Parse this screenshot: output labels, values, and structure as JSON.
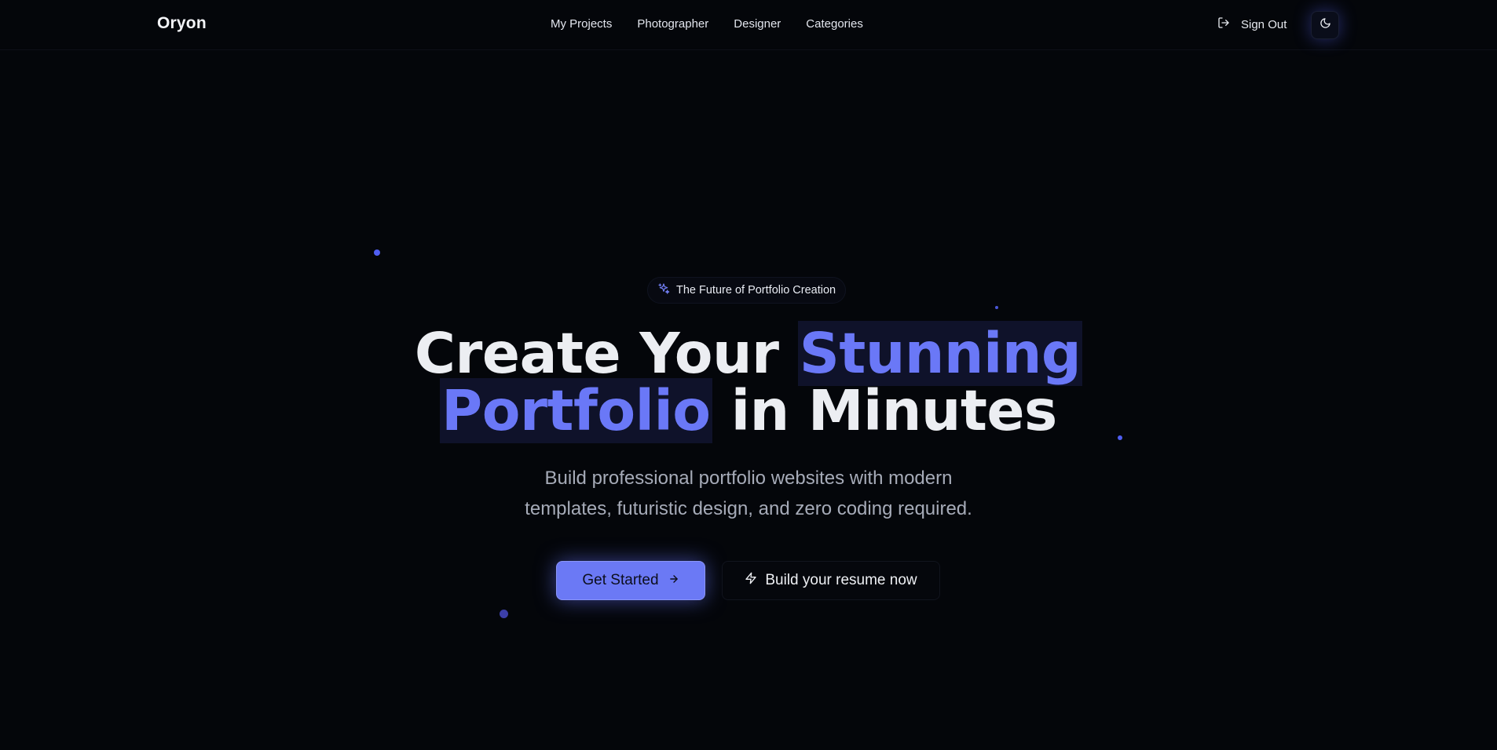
{
  "header": {
    "brand": "Oryon",
    "nav": [
      {
        "label": "My Projects"
      },
      {
        "label": "Photographer"
      },
      {
        "label": "Designer"
      },
      {
        "label": "Categories"
      }
    ],
    "sign_out_label": "Sign Out",
    "sign_out_icon": "log-out-icon",
    "theme_toggle_icon": "moon-icon"
  },
  "hero": {
    "badge_icon": "sparkles-icon",
    "badge_text": "The Future of Portfolio Creation",
    "headline": {
      "part1": "Create Your ",
      "highlight1": "Stunning",
      "highlight2": "Portfolio",
      "part2": " in Minutes"
    },
    "subtitle_line1": "Build professional portfolio websites with modern",
    "subtitle_line2": "templates, futuristic design, and zero coding required.",
    "primary_button": "Get Started",
    "primary_button_icon": "arrow-right-icon",
    "secondary_button": "Build your resume now",
    "secondary_button_icon": "zap-icon"
  },
  "colors": {
    "background": "#04060a",
    "accent": "#6b79f5",
    "highlight_text": "#6a78f7"
  }
}
